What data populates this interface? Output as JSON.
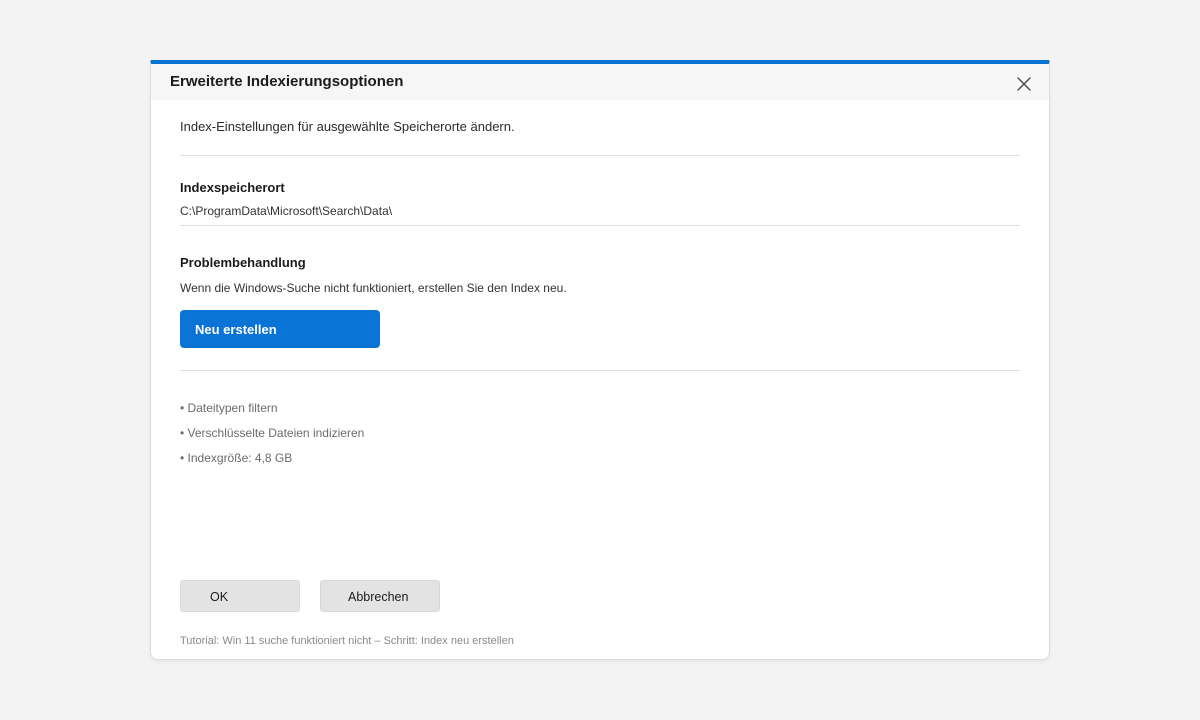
{
  "dialog": {
    "title": "Erweiterte Indexierungsoptionen",
    "close_icon": "close-icon",
    "accent_color": "#0a74d6"
  },
  "content": {
    "intro": "Index-Einstellungen für ausgewählte Speicherorte ändern.",
    "index_location": {
      "heading": "Indexspeicherort",
      "path": "C:\\ProgramData\\Microsoft\\Search\\Data\\"
    },
    "troubleshooting": {
      "heading": "Problembehandlung",
      "description": "Wenn die Windows-Suche nicht funktioniert, erstellen Sie den Index neu.",
      "rebuild_label": "Neu erstellen"
    },
    "bullets": [
      "• Dateitypen filtern",
      "• Verschlüsselte Dateien indizieren",
      "• Indexgröße: 4,8 GB"
    ]
  },
  "buttons": {
    "ok_label": "OK",
    "cancel_label": "Abbrechen"
  },
  "footer": {
    "text": "Tutorial: Win 11 suche funktioniert nicht – Schritt: Index neu erstellen"
  }
}
